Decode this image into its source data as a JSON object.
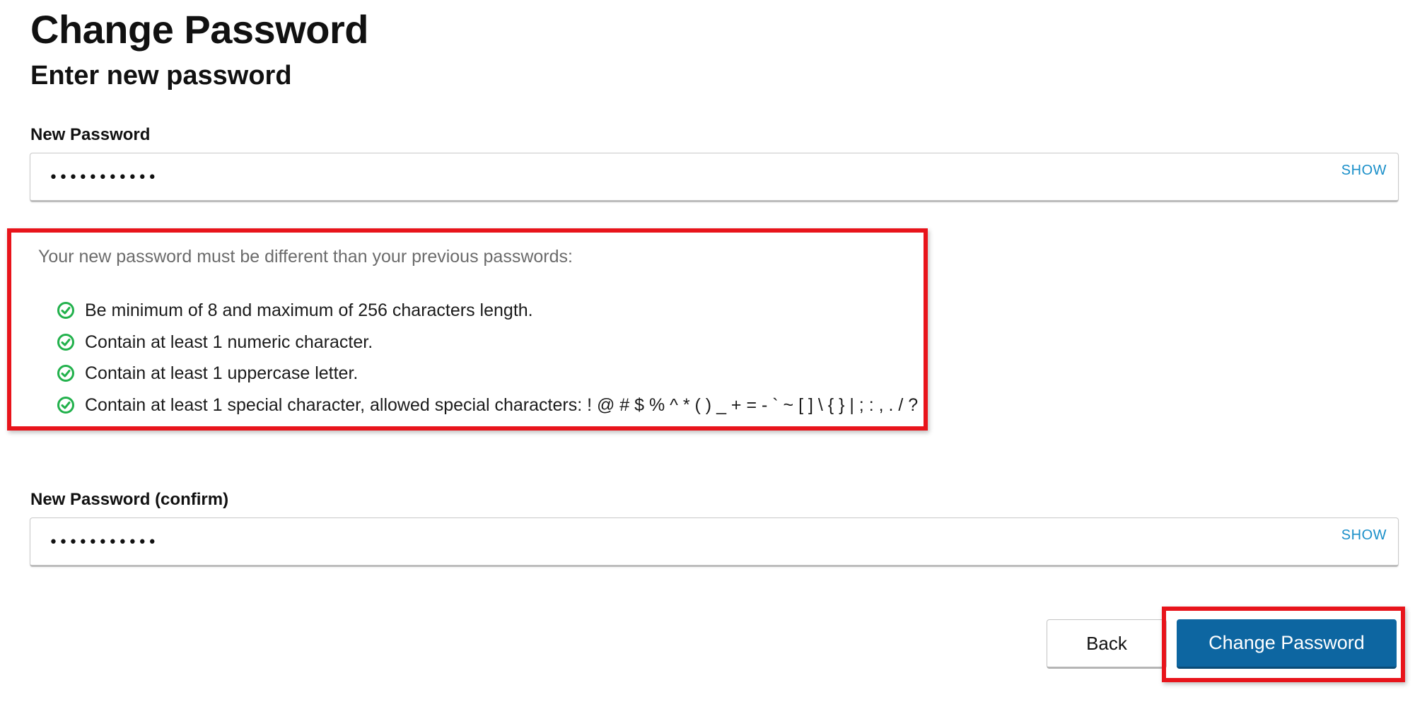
{
  "header": {
    "title": "Change Password",
    "subtitle": "Enter new password"
  },
  "form": {
    "new_password": {
      "label": "New Password",
      "value": "•••••••••••",
      "toggle_label": "SHOW"
    },
    "confirm_password": {
      "label": "New Password (confirm)",
      "value": "•••••••••••",
      "toggle_label": "SHOW"
    }
  },
  "requirements": {
    "intro": "Your new password must be different than your previous passwords:",
    "items": [
      {
        "text": "Be minimum of 8 and maximum of 256 characters length.",
        "icon": "check-circle-icon",
        "satisfied": true
      },
      {
        "text": "Contain at least 1 numeric character.",
        "icon": "check-circle-icon",
        "satisfied": true
      },
      {
        "text": "Contain at least 1 uppercase letter.",
        "icon": "check-circle-icon",
        "satisfied": true
      },
      {
        "text": "Contain at least 1 special character, allowed special characters: ! @ # $ % ^ * ( ) _ + = - ` ~ [ ] \\ { } | ; : , . / ?",
        "icon": "check-circle-icon",
        "satisfied": true
      }
    ]
  },
  "actions": {
    "back_label": "Back",
    "submit_label": "Change Password"
  },
  "colors": {
    "accent_link": "#1a8fc9",
    "primary_button": "#0d66a1",
    "check_green": "#22b14c",
    "highlight_red": "#e8141b"
  }
}
